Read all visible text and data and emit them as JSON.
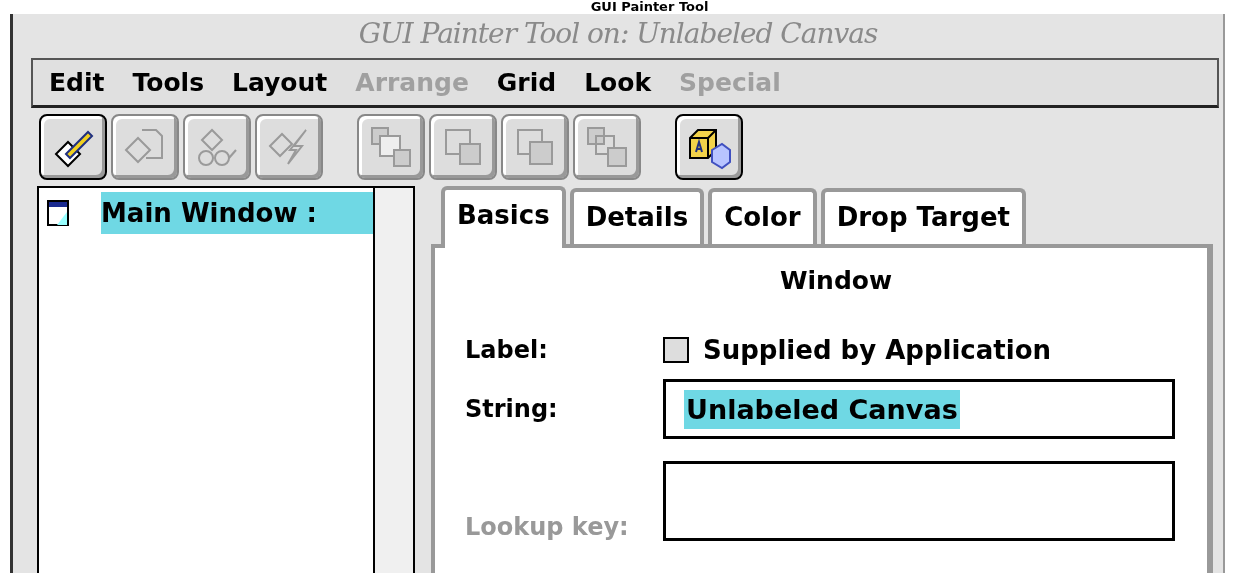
{
  "caption": "GUI Painter Tool",
  "window": {
    "title": "GUI Painter Tool on: Unlabeled Canvas"
  },
  "menu": [
    {
      "label": "Edit",
      "disabled": false
    },
    {
      "label": "Tools",
      "disabled": false
    },
    {
      "label": "Layout",
      "disabled": false
    },
    {
      "label": "Arrange",
      "disabled": true
    },
    {
      "label": "Grid",
      "disabled": false
    },
    {
      "label": "Look",
      "disabled": false
    },
    {
      "label": "Special",
      "disabled": true
    }
  ],
  "toolbar": [
    {
      "kind": "edit",
      "disabled": false
    },
    {
      "kind": "shapes",
      "disabled": true
    },
    {
      "kind": "glasses",
      "disabled": true
    },
    {
      "kind": "bolt",
      "disabled": true
    },
    {
      "kind": "front",
      "disabled": true
    },
    {
      "kind": "back",
      "disabled": true
    },
    {
      "kind": "forward",
      "disabled": true
    },
    {
      "kind": "backward",
      "disabled": true
    },
    {
      "kind": "cube",
      "disabled": false
    }
  ],
  "tree": {
    "items": [
      {
        "label": "Main Window : ",
        "selected": true
      }
    ]
  },
  "tabs": [
    {
      "label": "Basics",
      "selected": true
    },
    {
      "label": "Details",
      "selected": false
    },
    {
      "label": "Color",
      "selected": false
    },
    {
      "label": "Drop Target",
      "selected": false
    }
  ],
  "panel": {
    "heading": "Window",
    "label_row": {
      "label": "Label:",
      "checkbox": {
        "label": "Supplied by Application",
        "checked": false
      }
    },
    "string_row": {
      "label": "String:",
      "value": "Unlabeled Canvas"
    },
    "lookup_row": {
      "label": "Lookup key:",
      "disabled": true
    }
  }
}
